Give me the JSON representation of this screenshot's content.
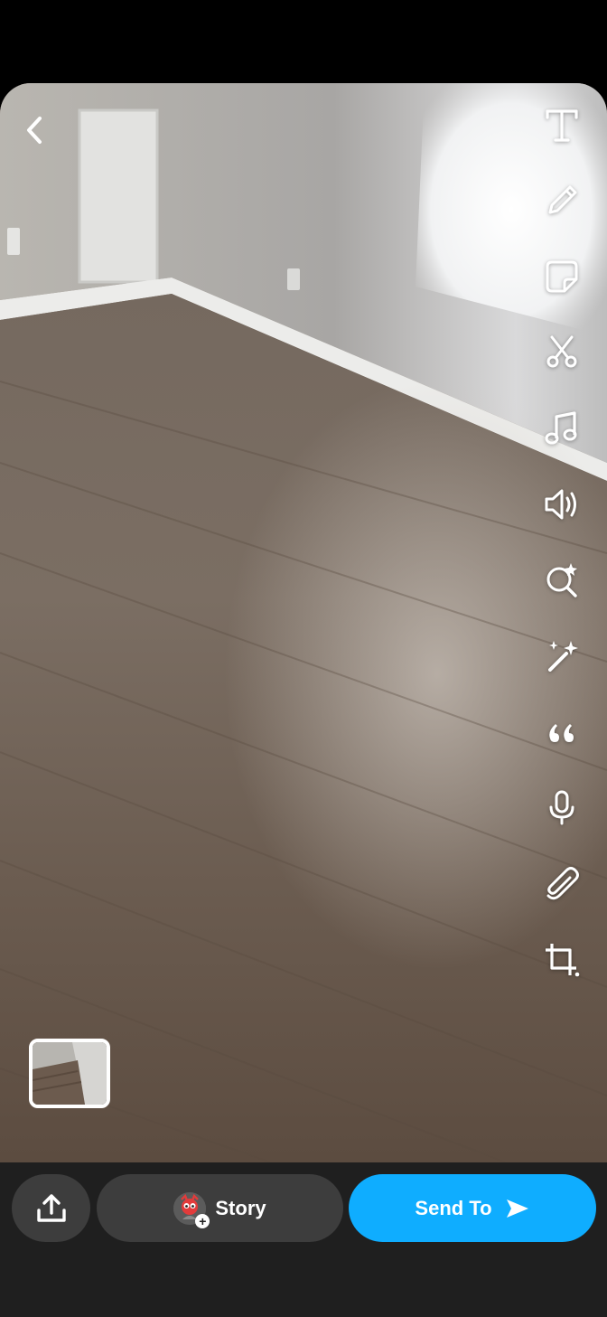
{
  "toolbar": {
    "tools": [
      {
        "icon": "text-icon"
      },
      {
        "icon": "pencil-icon"
      },
      {
        "icon": "sticker-icon"
      },
      {
        "icon": "scissors-icon"
      },
      {
        "icon": "music-note-icon"
      },
      {
        "icon": "speaker-icon"
      },
      {
        "icon": "lens-search-icon"
      },
      {
        "icon": "magic-wand-icon"
      },
      {
        "icon": "quote-icon"
      },
      {
        "icon": "microphone-icon"
      },
      {
        "icon": "paperclip-icon"
      },
      {
        "icon": "crop-icon"
      }
    ]
  },
  "bottom_bar": {
    "story_label": "Story",
    "send_label": "Send To"
  },
  "colors": {
    "send_button": "#0fadff",
    "pill_background": "#3d3d3d",
    "bottom_bar_background": "#1f1f1f"
  }
}
